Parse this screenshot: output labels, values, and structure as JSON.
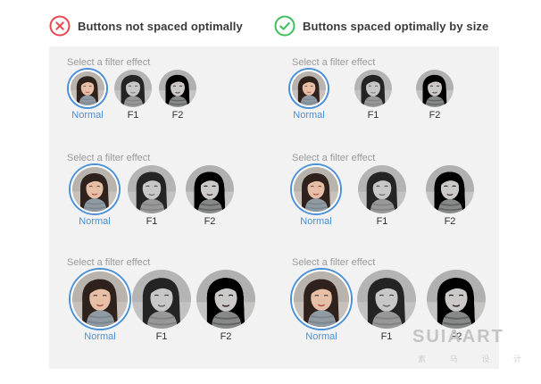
{
  "left_column": {
    "title": "Buttons not spaced optimally",
    "status_icon": "x-circle-icon",
    "status_color": "#e8474f",
    "sections": [
      {
        "prompt": "Select a filter effect",
        "options": [
          "Normal",
          "F1",
          "F2"
        ],
        "selected": "Normal"
      },
      {
        "prompt": "Select a filter effect",
        "options": [
          "Normal",
          "F1",
          "F2"
        ],
        "selected": "Normal"
      },
      {
        "prompt": "Select a filter effect",
        "options": [
          "Normal",
          "F1",
          "F2"
        ],
        "selected": "Normal"
      }
    ]
  },
  "right_column": {
    "title": "Buttons spaced optimally by size",
    "status_icon": "check-circle-icon",
    "status_color": "#3fbf5a",
    "sections": [
      {
        "prompt": "Select a filter effect",
        "options": [
          "Normal",
          "F1",
          "F2"
        ],
        "selected": "Normal"
      },
      {
        "prompt": "Select a filter effect",
        "options": [
          "Normal",
          "F1",
          "F2"
        ],
        "selected": "Normal"
      },
      {
        "prompt": "Select a filter effect",
        "options": [
          "Normal",
          "F1",
          "F2"
        ],
        "selected": "Normal"
      }
    ]
  },
  "colors": {
    "selected_accent": "#4a90d9",
    "panel_background": "#f2f2f2"
  },
  "watermark": {
    "main": "SUIAART",
    "sub": [
      "素",
      "马",
      "设",
      "计"
    ]
  }
}
